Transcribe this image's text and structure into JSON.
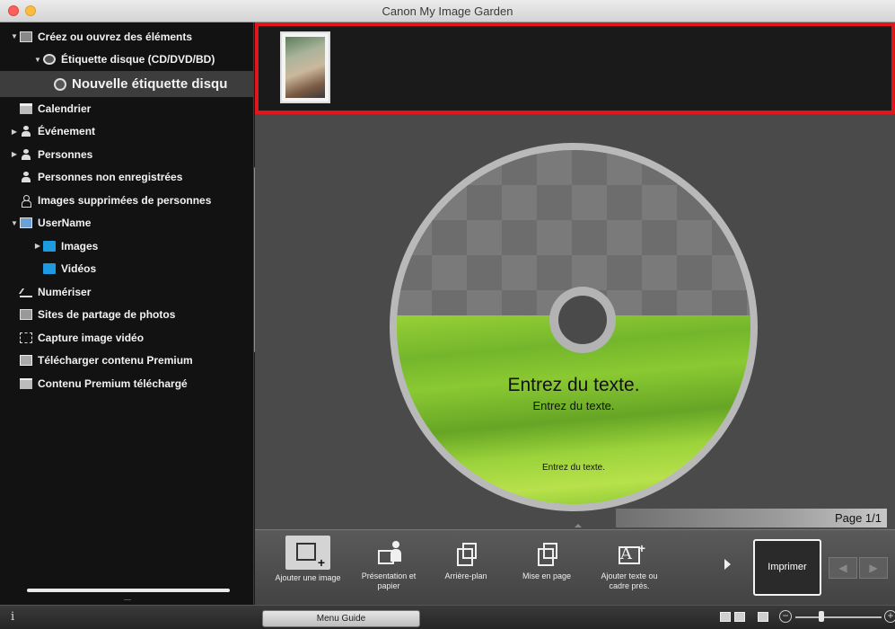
{
  "window": {
    "title": "Canon My Image Garden"
  },
  "sidebar": {
    "items": [
      {
        "label": "Créez ou ouvrez des éléments",
        "icon": "create-items-icon",
        "expanded": true
      },
      {
        "label": "Étiquette disque (CD/DVD/BD)",
        "icon": "disc-icon",
        "expanded": true
      },
      {
        "label": "Nouvelle étiquette disqu",
        "icon": "disc-icon",
        "selected": true
      },
      {
        "label": "Calendrier",
        "icon": "calendar-icon"
      },
      {
        "label": "Événement",
        "icon": "event-icon",
        "collapsed": true
      },
      {
        "label": "Personnes",
        "icon": "person-icon",
        "collapsed": true
      },
      {
        "label": "Personnes non enregistrées",
        "icon": "unregistered-person-icon"
      },
      {
        "label": "Images supprimées de personnes",
        "icon": "deleted-person-icon"
      },
      {
        "label": "UserName",
        "icon": "computer-icon",
        "expanded": true
      },
      {
        "label": "Images",
        "icon": "folder-icon",
        "collapsed": true
      },
      {
        "label": "Vidéos",
        "icon": "folder-icon"
      },
      {
        "label": "Numériser",
        "icon": "scan-icon"
      },
      {
        "label": "Sites de partage de photos",
        "icon": "photo-sharing-icon"
      },
      {
        "label": "Capture image vidéo",
        "icon": "video-capture-icon"
      },
      {
        "label": "Télécharger contenu Premium",
        "icon": "download-premium-icon"
      },
      {
        "label": "Contenu Premium téléchargé",
        "icon": "downloaded-premium-icon"
      }
    ]
  },
  "canvas": {
    "text_large": "Entrez du texte.",
    "text_small": "Entrez du texte.",
    "text_bottom": "Entrez du texte.",
    "page_indicator": "Page 1/1"
  },
  "toolbar": {
    "add_image": "Ajouter une image",
    "presentation": "Présentation et papier",
    "background": "Arrière-plan",
    "layout": "Mise en page",
    "add_text": "Ajouter texte ou cadre prés.",
    "print": "Imprimer"
  },
  "statusbar": {
    "info": "i",
    "menu_guide": "Menu Guide"
  },
  "colors": {
    "selection_highlight": "#e4141b",
    "disc_green": "#8ac932"
  }
}
